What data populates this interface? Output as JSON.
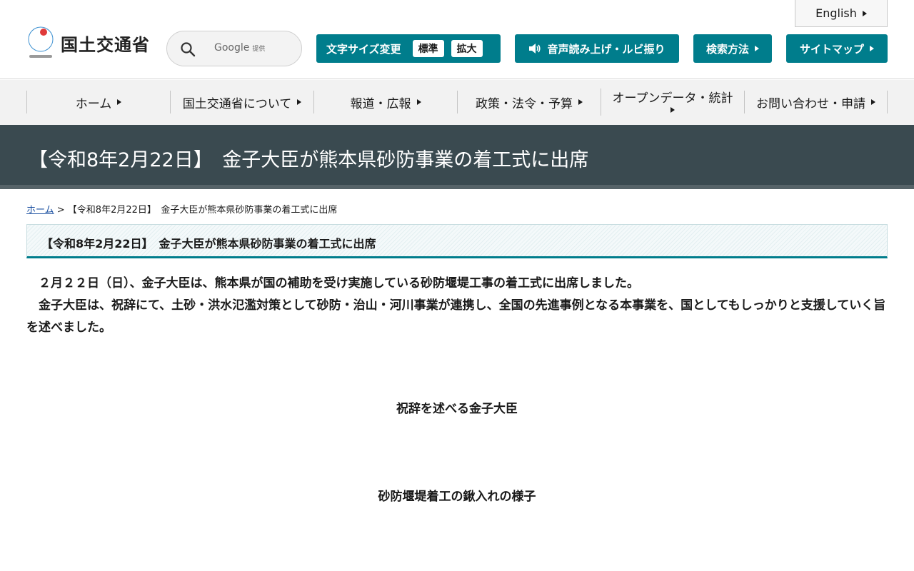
{
  "header": {
    "logo_text": "国土交通省",
    "search": {
      "brand": "Google",
      "brand_suffix": "提供"
    },
    "english_label": "English",
    "fontsize": {
      "label": "文字サイズ変更",
      "options": [
        "標準",
        "拡大"
      ]
    },
    "speech_label": "音声読み上げ・ルビ振り",
    "search_method_label": "検索方法",
    "sitemap_label": "サイトマップ"
  },
  "nav": {
    "items": [
      {
        "label": "ホーム"
      },
      {
        "label": "国土交通省について"
      },
      {
        "label": "報道・広報"
      },
      {
        "label": "政策・法令・予算"
      },
      {
        "label": "オープンデータ・統計"
      },
      {
        "label": "お問い合わせ・申請"
      }
    ]
  },
  "page": {
    "title": "【令和8年2月22日】　金子大臣が熊本県砂防事業の着工式に出席",
    "breadcrumb_home": "ホーム",
    "breadcrumb_sep": " > ",
    "breadcrumb_current": "【令和8年2月22日】　金子大臣が熊本県砂防事業の着工式に出席",
    "subheading": "【令和8年2月22日】　金子大臣が熊本県砂防事業の着工式に出席",
    "paragraphs": [
      "２月２２日（日）、金子大臣は、熊本県が国の補助を受け実施している砂防堰堤工事の着工式に出席しました。",
      "金子大臣は、祝辞にて、土砂・洪水氾濫対策として砂防・治山・河川事業が連携し、全国の先進事例となる本事業を、国としてもしっかりと支援していく旨を述べました。"
    ],
    "captions": [
      "祝辞を述べる金子大臣",
      "砂防堰堤着工の鍬入れの様子"
    ]
  },
  "colors": {
    "accent": "#007d8c",
    "title_band": "#3a4a50",
    "nav_bg": "#f2f2f2"
  }
}
